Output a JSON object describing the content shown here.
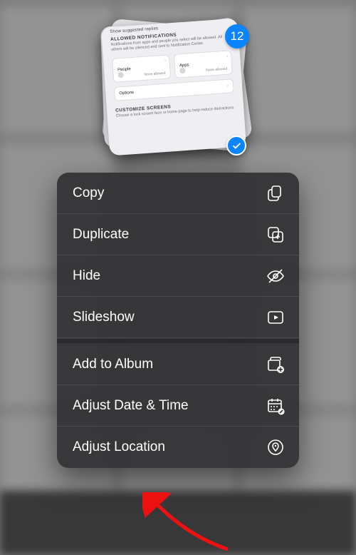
{
  "selection": {
    "count": "12",
    "selected": true
  },
  "thumbnail": {
    "cutoff_line": "Show suggested replies",
    "section1_header": "ALLOWED NOTIFICATIONS",
    "section1_desc": "Notifications from apps and people you select will be allowed. All others will be silenced and sent to Notification Center.",
    "box_people_label": "People",
    "box_people_value": "None allowed",
    "box_apps_label": "Apps",
    "box_apps_value": "None allowed",
    "options_label": "Options",
    "section2_header": "CUSTOMIZE SCREENS",
    "section2_desc": "Choose a lock screen face or home page to help reduce distractions."
  },
  "menu": {
    "groups": [
      {
        "items": [
          {
            "id": "copy",
            "label": "Copy",
            "icon": "copy-icon"
          },
          {
            "id": "duplicate",
            "label": "Duplicate",
            "icon": "duplicate-icon"
          },
          {
            "id": "hide",
            "label": "Hide",
            "icon": "eye-slash-icon"
          },
          {
            "id": "slideshow",
            "label": "Slideshow",
            "icon": "play-rect-icon"
          }
        ]
      },
      {
        "items": [
          {
            "id": "add-to-album",
            "label": "Add to Album",
            "icon": "album-add-icon"
          },
          {
            "id": "adjust-date-time",
            "label": "Adjust Date & Time",
            "icon": "calendar-edit-icon"
          },
          {
            "id": "adjust-location",
            "label": "Adjust Location",
            "icon": "map-pin-circle-icon"
          }
        ]
      }
    ]
  },
  "colors": {
    "accent": "#0a84ff",
    "menu_bg": "rgba(50,50,52,0.94)"
  }
}
